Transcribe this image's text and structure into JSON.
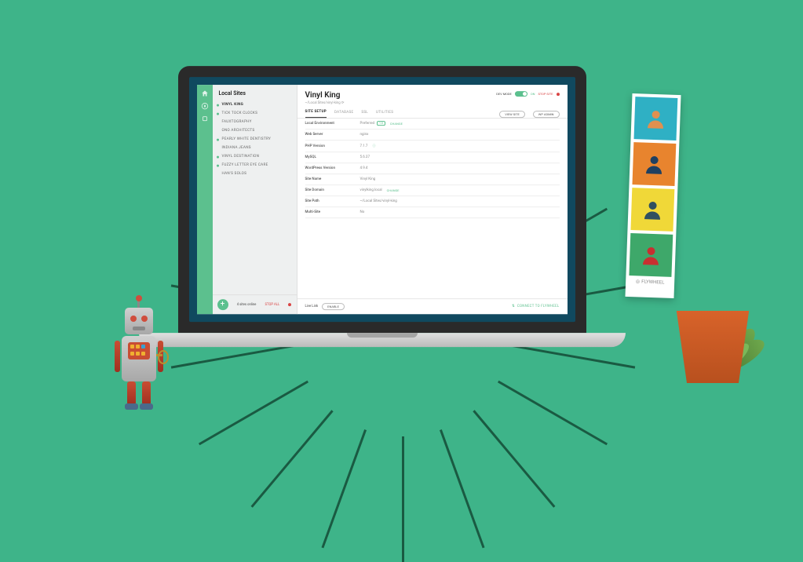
{
  "sidebar": {
    "title": "Local Sites",
    "items": [
      {
        "label": "VINYL KING",
        "active": true,
        "dot": true
      },
      {
        "label": "TICK TOCK CLOCKS",
        "dot": true
      },
      {
        "label": "FAUXTOGRAPHY"
      },
      {
        "label": "ONO ARCHITECTS"
      },
      {
        "label": "PEARLY WHITE DENTISTRY",
        "dot": true
      },
      {
        "label": "INDIANA JEANS"
      },
      {
        "label": "VINYL DESTINATION",
        "dot": true
      },
      {
        "label": "FUZZY LETTER EYE CARE",
        "dot": true
      },
      {
        "label": "HAN'S SOLOS"
      }
    ],
    "footer": {
      "sites_online": "4 sites online",
      "stop_all": "STOP ALL"
    }
  },
  "header": {
    "title": "Vinyl King",
    "path": "~/Local Sites/vinyl-king",
    "dev_mode": "DEV MODE",
    "toggle_on": "ON",
    "stop_site": "STOP SITE"
  },
  "tabs": {
    "site_setup": "SITE SETUP",
    "database": "DATABASE",
    "ssl": "SSL",
    "utilities": "UTILITIES",
    "view_site": "VIEW SITE",
    "wp_admin": "WP ADMIN"
  },
  "details": {
    "local_env": {
      "label": "Local Environment",
      "value": "Preferred",
      "tag": "1.0",
      "action": "CHANGE"
    },
    "web_server": {
      "label": "Web Server",
      "value": "nginx"
    },
    "php": {
      "label": "PHP Version",
      "value": "7.1.7"
    },
    "mysql": {
      "label": "MySQL",
      "value": "5.6.37"
    },
    "wp": {
      "label": "WordPress Version",
      "value": "4.9.4"
    },
    "site_name": {
      "label": "Site Name",
      "value": "Vinyl King"
    },
    "domain": {
      "label": "Site Domain",
      "value": "vinylking.local",
      "action": "CHANGE"
    },
    "site_path": {
      "label": "Site Path",
      "value": "~/Local Sites/vinyl-king"
    },
    "multisite": {
      "label": "Multi-Site",
      "value": "No"
    }
  },
  "footer": {
    "live_link": "Live Link",
    "enable": "ENABLE",
    "connect": "CONNECT TO FLYWHEEL"
  },
  "photostrip": {
    "brand": "FLYWHEEL"
  }
}
